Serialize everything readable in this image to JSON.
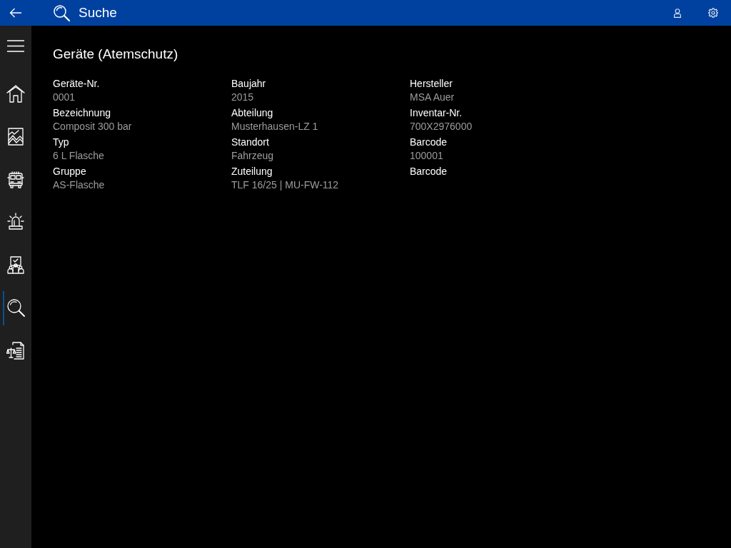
{
  "header": {
    "title": "Suche"
  },
  "sidebar": {
    "items": [
      {
        "selected": false
      },
      {
        "selected": false
      },
      {
        "selected": false
      },
      {
        "selected": false
      },
      {
        "selected": false
      },
      {
        "selected": true
      },
      {
        "selected": false
      }
    ]
  },
  "page": {
    "title": "Geräte (Atemschutz)",
    "columns": [
      [
        {
          "label": "Geräte-Nr.",
          "value": "0001"
        },
        {
          "label": "Bezeichnung",
          "value": "Composit 300 bar"
        },
        {
          "label": "Typ",
          "value": "6 L Flasche"
        },
        {
          "label": "Gruppe",
          "value": "AS-Flasche"
        }
      ],
      [
        {
          "label": "Baujahr",
          "value": "2015"
        },
        {
          "label": "Abteilung",
          "value": "Musterhausen-LZ 1"
        },
        {
          "label": "Standort",
          "value": "Fahrzeug"
        },
        {
          "label": "Zuteilung",
          "value": "TLF 16/25 | MU-FW-112"
        }
      ],
      [
        {
          "label": "Hersteller",
          "value": "MSA Auer"
        },
        {
          "label": "Inventar-Nr.",
          "value": "700X2976000"
        },
        {
          "label": "Barcode",
          "value": "100001"
        },
        {
          "label": "Barcode"
        }
      ]
    ]
  }
}
